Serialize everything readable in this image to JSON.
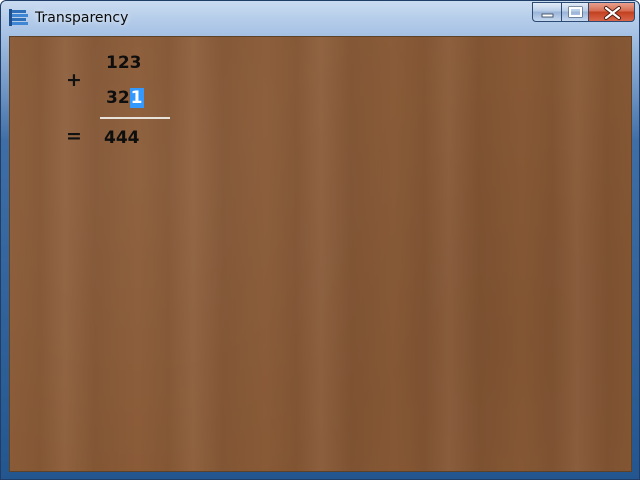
{
  "window": {
    "title": "Transparency",
    "icon": "app-icon"
  },
  "caption": {
    "minimize_icon": "minimize-icon",
    "maximize_icon": "maximize-icon",
    "close_icon": "close-icon"
  },
  "calc": {
    "plus_sign": "+",
    "operand1": "123",
    "operand2_unselected": "32",
    "operand2_selected": "1",
    "equals_sign": "=",
    "result": "444"
  },
  "colors": {
    "selection": "#3399ff",
    "background": "#8a5a36",
    "close_button": "#c2401f"
  }
}
